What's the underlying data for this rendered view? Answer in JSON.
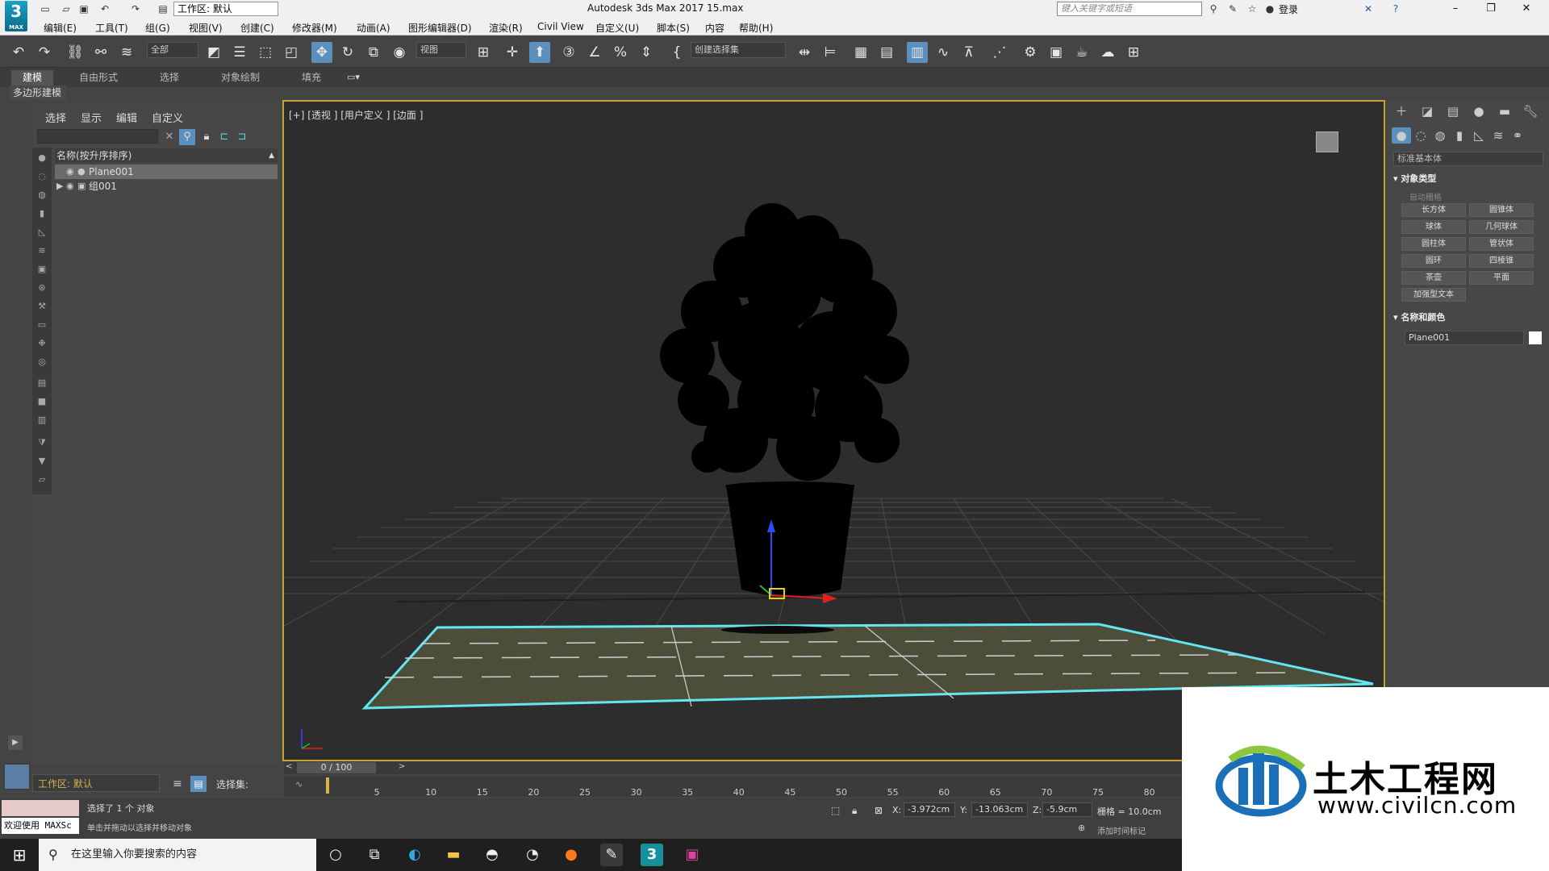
{
  "titlebar": {
    "workspace": "工作区: 默认",
    "app_title": "Autodesk 3ds Max 2017      15.max",
    "search_placeholder": "键入关键字或短语",
    "login": "登录",
    "minimize_glyph": "–",
    "restore_glyph": "❐",
    "close_glyph": "✕"
  },
  "logo": {
    "number": "3",
    "text": "MAX"
  },
  "menus": [
    "编辑(E)",
    "工具(T)",
    "组(G)",
    "视图(V)",
    "创建(C)",
    "修改器(M)",
    "动画(A)",
    "图形编辑器(D)",
    "渲染(R)",
    "Civil View",
    "自定义(U)",
    "脚本(S)",
    "内容",
    "帮助(H)"
  ],
  "toolbar": {
    "filter_all": "全部",
    "ref_coord": "视图",
    "named_selection": "创建选择集"
  },
  "ribbon": {
    "tabs": [
      "建模",
      "自由形式",
      "选择",
      "对象绘制",
      "填充"
    ],
    "active_tab": "建模",
    "sub_label": "多边形建模"
  },
  "explorer": {
    "menus": [
      "选择",
      "显示",
      "编辑",
      "自定义"
    ],
    "column_header": "名称(按升序排序)",
    "rows": [
      {
        "name": "Plane001",
        "selected": true
      },
      {
        "name": "组001",
        "selected": false
      }
    ]
  },
  "viewport": {
    "label": "[+] [透视 ] [用户定义 ] [边面 ]"
  },
  "command_panel": {
    "dropdown": "标准基本体",
    "object_type_title": "对象类型",
    "autogrid": "自动栅格",
    "buttons": [
      "长方体",
      "圆锥体",
      "球体",
      "几何球体",
      "圆柱体",
      "管状体",
      "圆环",
      "四棱锥",
      "茶壶",
      "平面",
      "加强型文本"
    ],
    "name_color_title": "名称和颜色",
    "object_name": "Plane001",
    "object_color": "#ffffff"
  },
  "timeline": {
    "slider_label": "0 / 100",
    "ticks": [
      "5",
      "10",
      "15",
      "20",
      "25",
      "30",
      "35",
      "40",
      "45",
      "50",
      "55",
      "60",
      "65",
      "70",
      "75",
      "80"
    ]
  },
  "bottom": {
    "workspace": "工作区: 默认",
    "selection_set_label": "选择集:",
    "welcome": "欢迎使用 MAXSc",
    "status_line1": "选择了 1 个 对象",
    "status_line2": "单击并拖动以选择并移动对象",
    "x_label": "X:",
    "x_value": "-3.972cm",
    "y_label": "Y:",
    "y_value": "-13.063cm",
    "z_label": "Z:",
    "z_value": "-5.9cm",
    "grid": "栅格 = 10.0cm",
    "time_tag": "添加时间标记"
  },
  "taskbar": {
    "search_placeholder": "在这里输入你要搜索的内容"
  },
  "watermark": {
    "cn_text": "土木工程网",
    "url": "www.civilcn.com"
  }
}
